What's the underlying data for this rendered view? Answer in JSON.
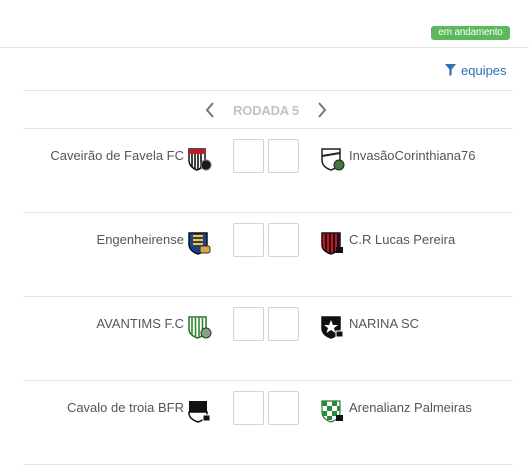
{
  "status": {
    "label": "em andamento",
    "color": "#5cb85c"
  },
  "filter": {
    "label": "equipes",
    "icon": "filter-icon"
  },
  "round": {
    "label": "RODADA 5",
    "prev_icon": "chevron-left-icon",
    "next_icon": "chevron-right-icon"
  },
  "matches": [
    {
      "home": "Caveirão de Favela FC",
      "away": "InvasãoCorinthiana76",
      "home_score": "",
      "away_score": ""
    },
    {
      "home": "Engenheirense",
      "away": "C.R Lucas Pereira",
      "home_score": "",
      "away_score": ""
    },
    {
      "home": "AVANTIMS F.C",
      "away": "NARINA SC",
      "home_score": "",
      "away_score": ""
    },
    {
      "home": "Cavalo de troia BFR",
      "away": "Arenalianz Palmeiras",
      "home_score": "",
      "away_score": ""
    }
  ]
}
